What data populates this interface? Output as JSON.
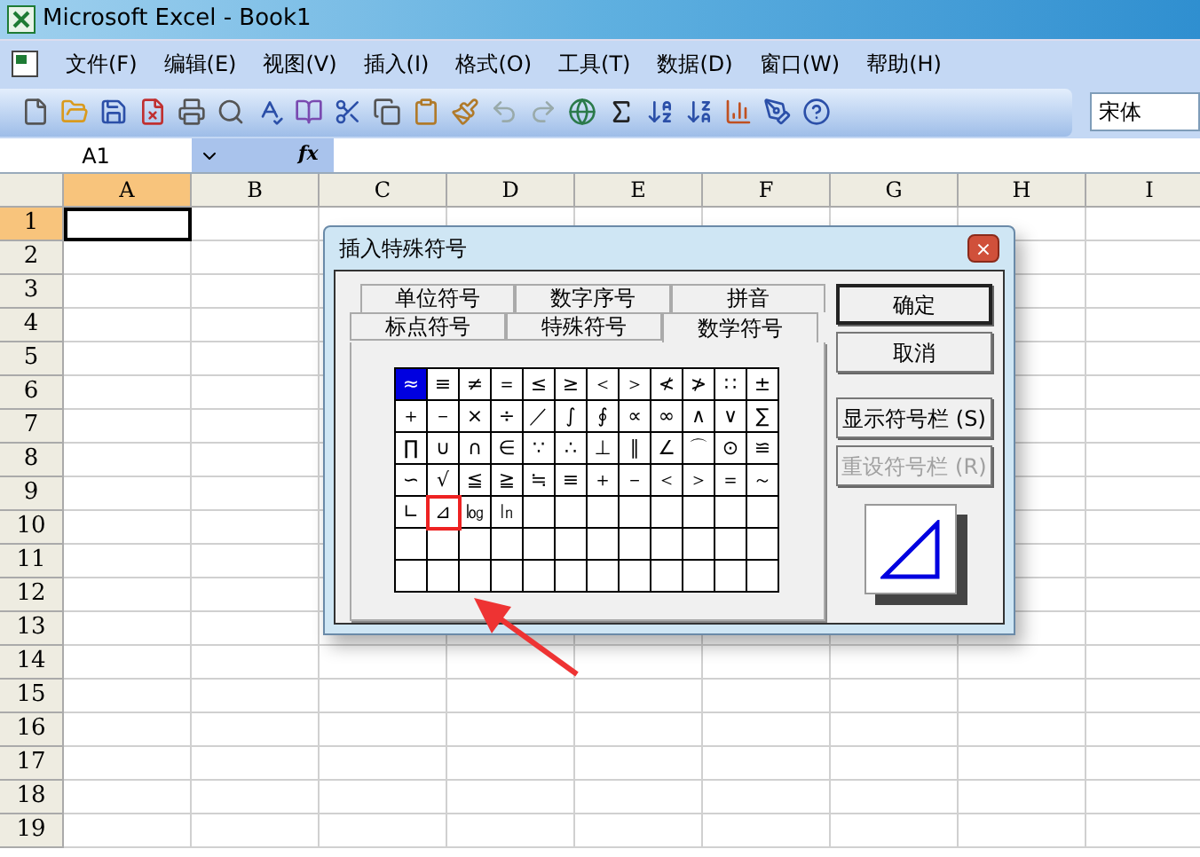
{
  "window": {
    "title": "Microsoft Excel - Book1"
  },
  "menu": [
    "文件(F)",
    "编辑(E)",
    "视图(V)",
    "插入(I)",
    "格式(O)",
    "工具(T)",
    "数据(D)",
    "窗口(W)",
    "帮助(H)"
  ],
  "toolbar": {
    "font": "宋体"
  },
  "formula_bar": {
    "name_box": "A1",
    "fx": "fx"
  },
  "sheet": {
    "columns": [
      {
        "label": "A",
        "selected": true
      },
      {
        "label": "B",
        "selected": false
      },
      {
        "label": "C",
        "selected": false
      },
      {
        "label": "D",
        "selected": false
      },
      {
        "label": "E",
        "selected": false
      },
      {
        "label": "F",
        "selected": false
      },
      {
        "label": "G",
        "selected": false
      },
      {
        "label": "H",
        "selected": false
      },
      {
        "label": "I",
        "selected": false
      }
    ],
    "rows": [
      {
        "label": "1",
        "selected": true
      },
      {
        "label": "2",
        "selected": false
      },
      {
        "label": "3",
        "selected": false
      },
      {
        "label": "4",
        "selected": false
      },
      {
        "label": "5",
        "selected": false
      },
      {
        "label": "6",
        "selected": false
      },
      {
        "label": "7",
        "selected": false
      },
      {
        "label": "8",
        "selected": false
      },
      {
        "label": "9",
        "selected": false
      },
      {
        "label": "10",
        "selected": false
      },
      {
        "label": "11",
        "selected": false
      },
      {
        "label": "12",
        "selected": false
      },
      {
        "label": "13",
        "selected": false
      },
      {
        "label": "14",
        "selected": false
      },
      {
        "label": "15",
        "selected": false
      },
      {
        "label": "16",
        "selected": false
      },
      {
        "label": "17",
        "selected": false
      },
      {
        "label": "18",
        "selected": false
      },
      {
        "label": "19",
        "selected": false
      }
    ]
  },
  "dialog": {
    "title": "插入特殊符号",
    "close": "×",
    "tabs_back": [
      {
        "label": "单位符号",
        "selected": false
      },
      {
        "label": "数字序号",
        "selected": false
      },
      {
        "label": "拼音",
        "selected": false
      }
    ],
    "tabs_front": [
      {
        "label": "标点符号",
        "selected": false
      },
      {
        "label": "特殊符号",
        "selected": false
      },
      {
        "label": "数学符号",
        "selected": true
      }
    ],
    "symbols": [
      {
        "char": "≈",
        "selected": true,
        "marked": false
      },
      {
        "char": "≡",
        "selected": false,
        "marked": false
      },
      {
        "char": "≠",
        "selected": false,
        "marked": false
      },
      {
        "char": "＝",
        "selected": false,
        "marked": false
      },
      {
        "char": "≤",
        "selected": false,
        "marked": false
      },
      {
        "char": "≥",
        "selected": false,
        "marked": false
      },
      {
        "char": "＜",
        "selected": false,
        "marked": false
      },
      {
        "char": "＞",
        "selected": false,
        "marked": false
      },
      {
        "char": "≮",
        "selected": false,
        "marked": false
      },
      {
        "char": "≯",
        "selected": false,
        "marked": false
      },
      {
        "char": "∷",
        "selected": false,
        "marked": false
      },
      {
        "char": "±",
        "selected": false,
        "marked": false
      },
      {
        "char": "＋",
        "selected": false,
        "marked": false
      },
      {
        "char": "－",
        "selected": false,
        "marked": false
      },
      {
        "char": "×",
        "selected": false,
        "marked": false
      },
      {
        "char": "÷",
        "selected": false,
        "marked": false
      },
      {
        "char": "／",
        "selected": false,
        "marked": false
      },
      {
        "char": "∫",
        "selected": false,
        "marked": false
      },
      {
        "char": "∮",
        "selected": false,
        "marked": false
      },
      {
        "char": "∝",
        "selected": false,
        "marked": false
      },
      {
        "char": "∞",
        "selected": false,
        "marked": false
      },
      {
        "char": "∧",
        "selected": false,
        "marked": false
      },
      {
        "char": "∨",
        "selected": false,
        "marked": false
      },
      {
        "char": "∑",
        "selected": false,
        "marked": false
      },
      {
        "char": "∏",
        "selected": false,
        "marked": false
      },
      {
        "char": "∪",
        "selected": false,
        "marked": false
      },
      {
        "char": "∩",
        "selected": false,
        "marked": false
      },
      {
        "char": "∈",
        "selected": false,
        "marked": false
      },
      {
        "char": "∵",
        "selected": false,
        "marked": false
      },
      {
        "char": "∴",
        "selected": false,
        "marked": false
      },
      {
        "char": "⊥",
        "selected": false,
        "marked": false
      },
      {
        "char": "∥",
        "selected": false,
        "marked": false
      },
      {
        "char": "∠",
        "selected": false,
        "marked": false
      },
      {
        "char": "⌒",
        "selected": false,
        "marked": false
      },
      {
        "char": "⊙",
        "selected": false,
        "marked": false
      },
      {
        "char": "≌",
        "selected": false,
        "marked": false
      },
      {
        "char": "∽",
        "selected": false,
        "marked": false
      },
      {
        "char": "√",
        "selected": false,
        "marked": false
      },
      {
        "char": "≦",
        "selected": false,
        "marked": false
      },
      {
        "char": "≧",
        "selected": false,
        "marked": false
      },
      {
        "char": "≒",
        "selected": false,
        "marked": false
      },
      {
        "char": "≡",
        "selected": false,
        "marked": false
      },
      {
        "char": "＋",
        "selected": false,
        "marked": false
      },
      {
        "char": "－",
        "selected": false,
        "marked": false
      },
      {
        "char": "＜",
        "selected": false,
        "marked": false
      },
      {
        "char": "＞",
        "selected": false,
        "marked": false
      },
      {
        "char": "＝",
        "selected": false,
        "marked": false
      },
      {
        "char": "～",
        "selected": false,
        "marked": false
      },
      {
        "char": "∟",
        "selected": false,
        "marked": false
      },
      {
        "char": "⊿",
        "selected": false,
        "marked": true
      },
      {
        "char": "㏒",
        "selected": false,
        "marked": false
      },
      {
        "char": "㏑",
        "selected": false,
        "marked": false
      }
    ],
    "buttons": [
      {
        "label": "确定",
        "kind": "default",
        "disabled": false
      },
      {
        "label": "取消",
        "kind": "normal",
        "disabled": false
      },
      {
        "label": "显示符号栏 (S)",
        "kind": "normal",
        "disabled": false
      },
      {
        "label": "重设符号栏 (R)",
        "kind": "normal",
        "disabled": true
      }
    ]
  }
}
